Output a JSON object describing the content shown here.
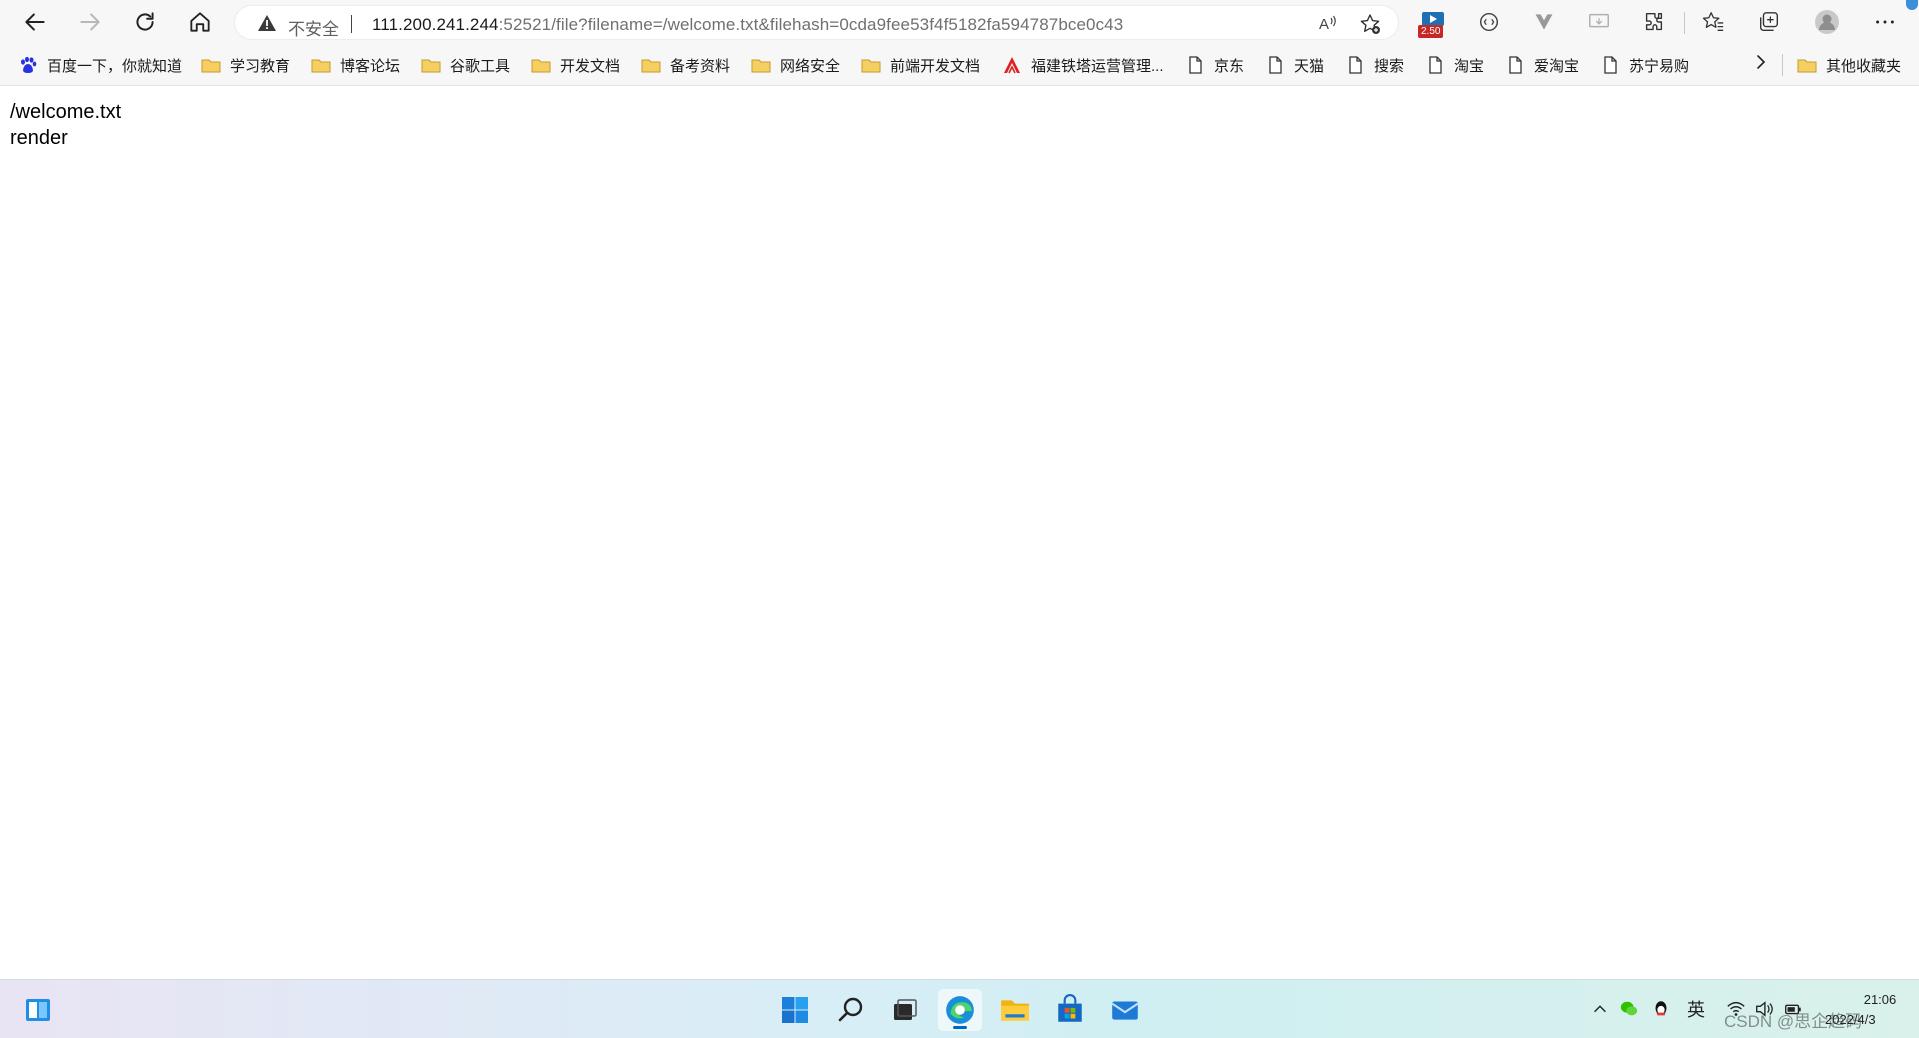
{
  "browser": {
    "security_label": "不安全",
    "url_host": "111.200.241.244",
    "url_rest": ":52521/file?filename=/welcome.txt&filehash=0cda9fee53f4f5182fa594787bce0c43",
    "extension_badge": "2.50",
    "icons": {
      "back": "back-arrow-icon",
      "forward": "forward-arrow-icon",
      "refresh": "refresh-icon",
      "home": "home-icon",
      "read_aloud": "read-aloud-icon",
      "add_favorite": "add-favorite-icon",
      "collections": "collections-icon",
      "favorites": "favorites-icon",
      "extensions": "extensions-icon",
      "profile": "profile-icon",
      "menu": "more-menu-icon"
    }
  },
  "bookmarks": {
    "items": [
      {
        "label": "百度一下，你就知道",
        "type": "baidu"
      },
      {
        "label": "学习教育",
        "type": "folder"
      },
      {
        "label": "博客论坛",
        "type": "folder"
      },
      {
        "label": "谷歌工具",
        "type": "folder"
      },
      {
        "label": "开发文档",
        "type": "folder"
      },
      {
        "label": "备考资料",
        "type": "folder"
      },
      {
        "label": "网络安全",
        "type": "folder"
      },
      {
        "label": "前端开发文档",
        "type": "folder"
      },
      {
        "label": "福建铁塔运营管理...",
        "type": "logo"
      },
      {
        "label": "京东",
        "type": "page"
      },
      {
        "label": "天猫",
        "type": "page"
      },
      {
        "label": "搜索",
        "type": "page"
      },
      {
        "label": "淘宝",
        "type": "page"
      },
      {
        "label": "爱淘宝",
        "type": "page"
      },
      {
        "label": "苏宁易购",
        "type": "page"
      }
    ],
    "other": "其他收藏夹"
  },
  "page": {
    "line1": "/welcome.txt",
    "line2": "render"
  },
  "taskbar": {
    "ime": "英",
    "time": "21:06",
    "date": "2022/4/3",
    "watermark": "CSDN @思企趋码"
  },
  "colors": {
    "accent": "#0067c0",
    "toolbar_bg": "#f7f7f7",
    "folder": "#f2c14e"
  }
}
